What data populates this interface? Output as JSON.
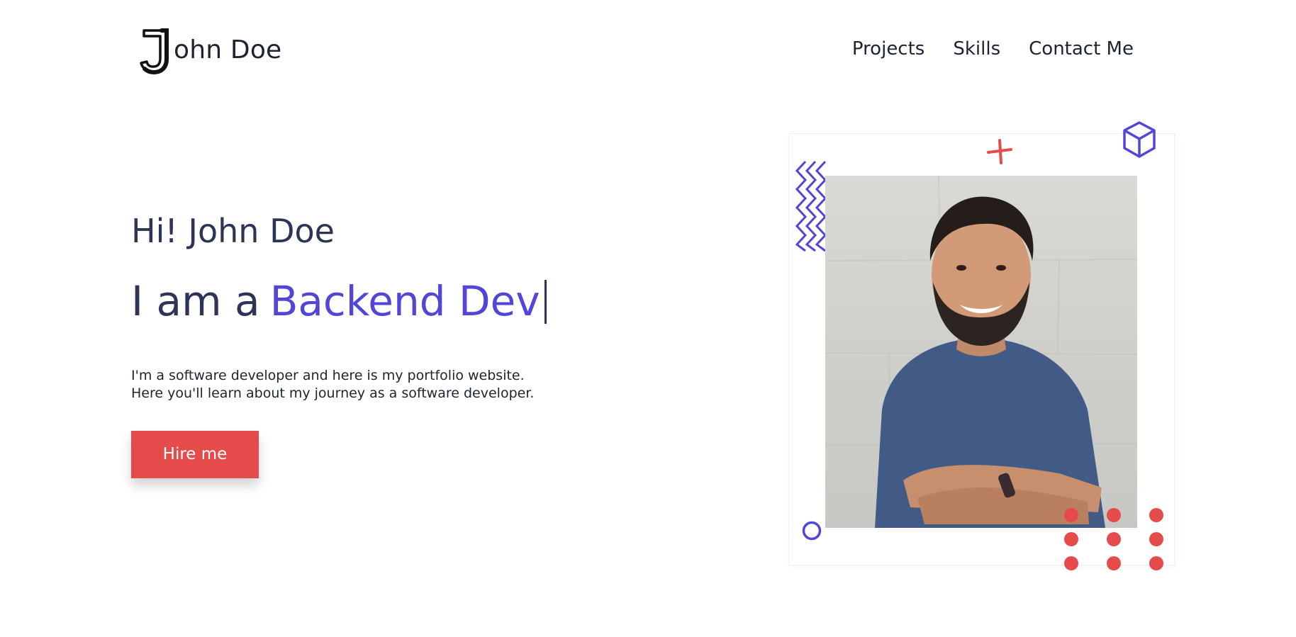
{
  "brand": {
    "logo_letter": "J",
    "name_rest": "ohn Doe"
  },
  "nav": {
    "items": [
      {
        "label": "Projects"
      },
      {
        "label": "Skills"
      },
      {
        "label": "Contact Me"
      }
    ]
  },
  "hero": {
    "greeting": "Hi! John Doe",
    "prefix": "I am a",
    "role": "Backend Dev",
    "description_line1": "I'm a software developer and here is my portfolio website.",
    "description_line2": "Here you'll learn about my journey as a software developer.",
    "cta": "Hire me"
  },
  "colors": {
    "accent": "#5046d8",
    "cta": "#e64b4b",
    "text": "#2d3557"
  },
  "icons": {
    "cube": "cube-icon",
    "plus": "plus-icon",
    "zigzag": "zigzag-icon",
    "ring": "ring-icon",
    "dots": "dots-grid-icon",
    "logo": "logo-j-icon"
  }
}
